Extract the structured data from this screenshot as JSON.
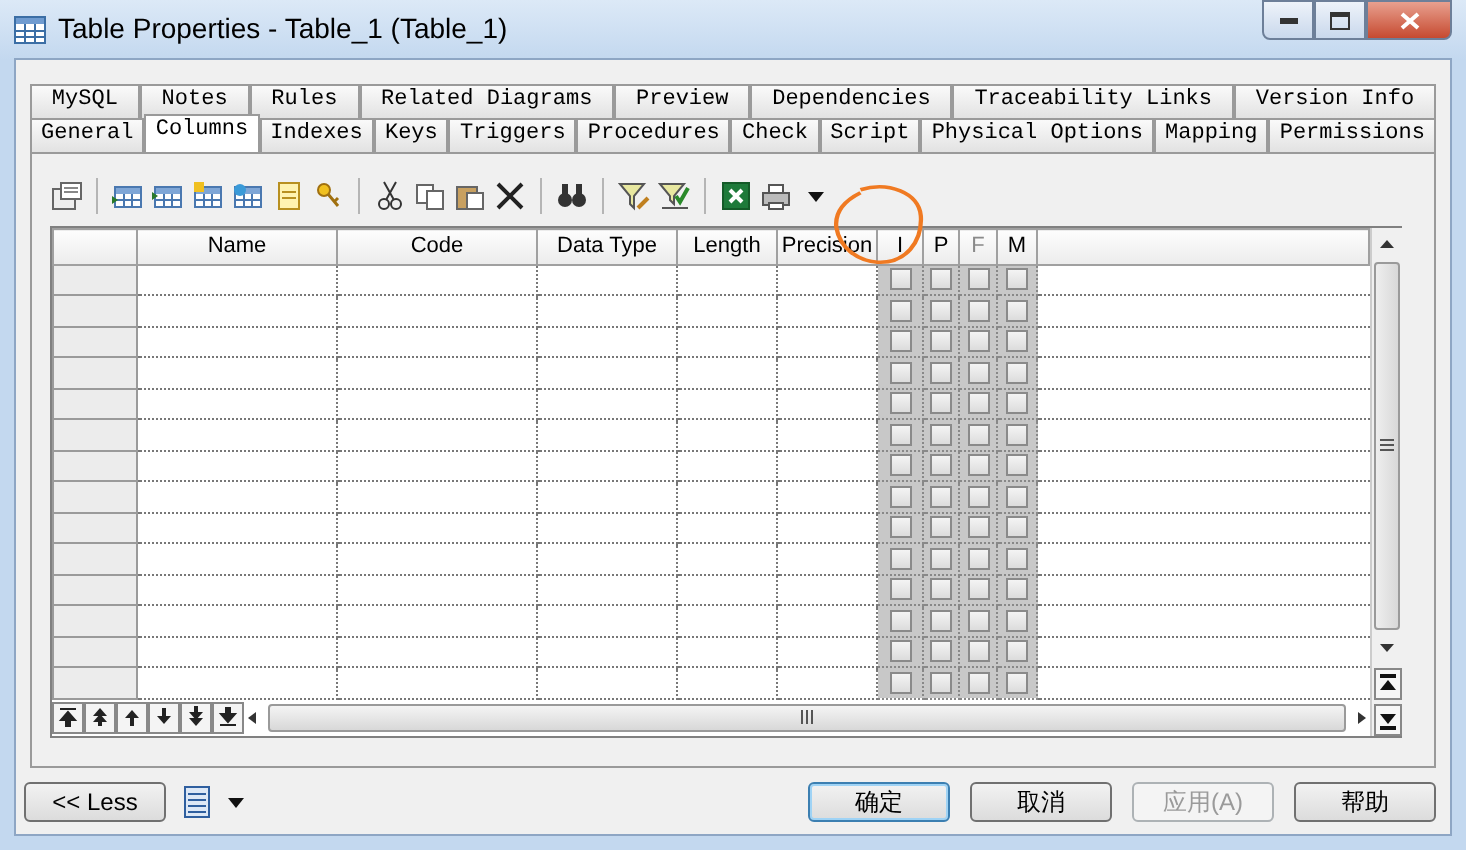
{
  "window": {
    "title": "Table Properties - Table_1 (Table_1)"
  },
  "tab_rows": [
    [
      {
        "label": "MySQL",
        "selected": false
      },
      {
        "label": "Notes",
        "selected": false
      },
      {
        "label": "Rules",
        "selected": false
      },
      {
        "label": "Related Diagrams",
        "selected": false
      },
      {
        "label": "Preview",
        "selected": false
      },
      {
        "label": "Dependencies",
        "selected": false
      },
      {
        "label": "Traceability Links",
        "selected": false
      },
      {
        "label": "Version Info",
        "selected": false
      }
    ],
    [
      {
        "label": "General",
        "selected": false
      },
      {
        "label": "Columns",
        "selected": true
      },
      {
        "label": "Indexes",
        "selected": false
      },
      {
        "label": "Keys",
        "selected": false
      },
      {
        "label": "Triggers",
        "selected": false
      },
      {
        "label": "Procedures",
        "selected": false
      },
      {
        "label": "Check",
        "selected": false
      },
      {
        "label": "Script",
        "selected": false
      },
      {
        "label": "Physical Options",
        "selected": false
      },
      {
        "label": "Mapping",
        "selected": false
      },
      {
        "label": "Permissions",
        "selected": false
      }
    ]
  ],
  "grid": {
    "columns": [
      {
        "label": "Name",
        "kind": "text",
        "disabled": false
      },
      {
        "label": "Code",
        "kind": "text",
        "disabled": false
      },
      {
        "label": "Data Type",
        "kind": "text",
        "disabled": false
      },
      {
        "label": "Length",
        "kind": "text",
        "disabled": false
      },
      {
        "label": "Precision",
        "kind": "text",
        "disabled": false
      },
      {
        "label": "I",
        "kind": "check",
        "disabled": false
      },
      {
        "label": "P",
        "kind": "check",
        "disabled": false
      },
      {
        "label": "F",
        "kind": "check",
        "disabled": true
      },
      {
        "label": "M",
        "kind": "check",
        "disabled": false
      }
    ],
    "rows": [
      {
        "checks": [
          false,
          false,
          false,
          false
        ]
      },
      {
        "checks": [
          false,
          false,
          false,
          false
        ]
      },
      {
        "checks": [
          false,
          false,
          false,
          false
        ]
      },
      {
        "checks": [
          false,
          false,
          false,
          false
        ]
      },
      {
        "checks": [
          false,
          false,
          false,
          false
        ]
      },
      {
        "checks": [
          false,
          false,
          false,
          false
        ]
      },
      {
        "checks": [
          false,
          false,
          false,
          false
        ]
      },
      {
        "checks": [
          false,
          false,
          false,
          false
        ]
      },
      {
        "checks": [
          false,
          false,
          false,
          false
        ]
      },
      {
        "checks": [
          false,
          false,
          false,
          false
        ]
      },
      {
        "checks": [
          false,
          false,
          false,
          false
        ]
      },
      {
        "checks": [
          false,
          false,
          false,
          false
        ]
      },
      {
        "checks": [
          false,
          false,
          false,
          false
        ]
      },
      {
        "checks": [
          false,
          false,
          false,
          false
        ]
      }
    ]
  },
  "annotations": [
    {
      "kind": "circle"
    }
  ],
  "buttons": [
    {
      "label": "<< Less",
      "kind": "toggle",
      "default": false,
      "disabled": false
    },
    {
      "label": "确定",
      "kind": "dialog",
      "default": true,
      "disabled": false
    },
    {
      "label": "取消",
      "kind": "dialog",
      "default": false,
      "disabled": false
    },
    {
      "label": "应用(A)",
      "kind": "dialog",
      "default": false,
      "disabled": true
    },
    {
      "label": "帮助",
      "kind": "dialog",
      "default": false,
      "disabled": false
    }
  ]
}
